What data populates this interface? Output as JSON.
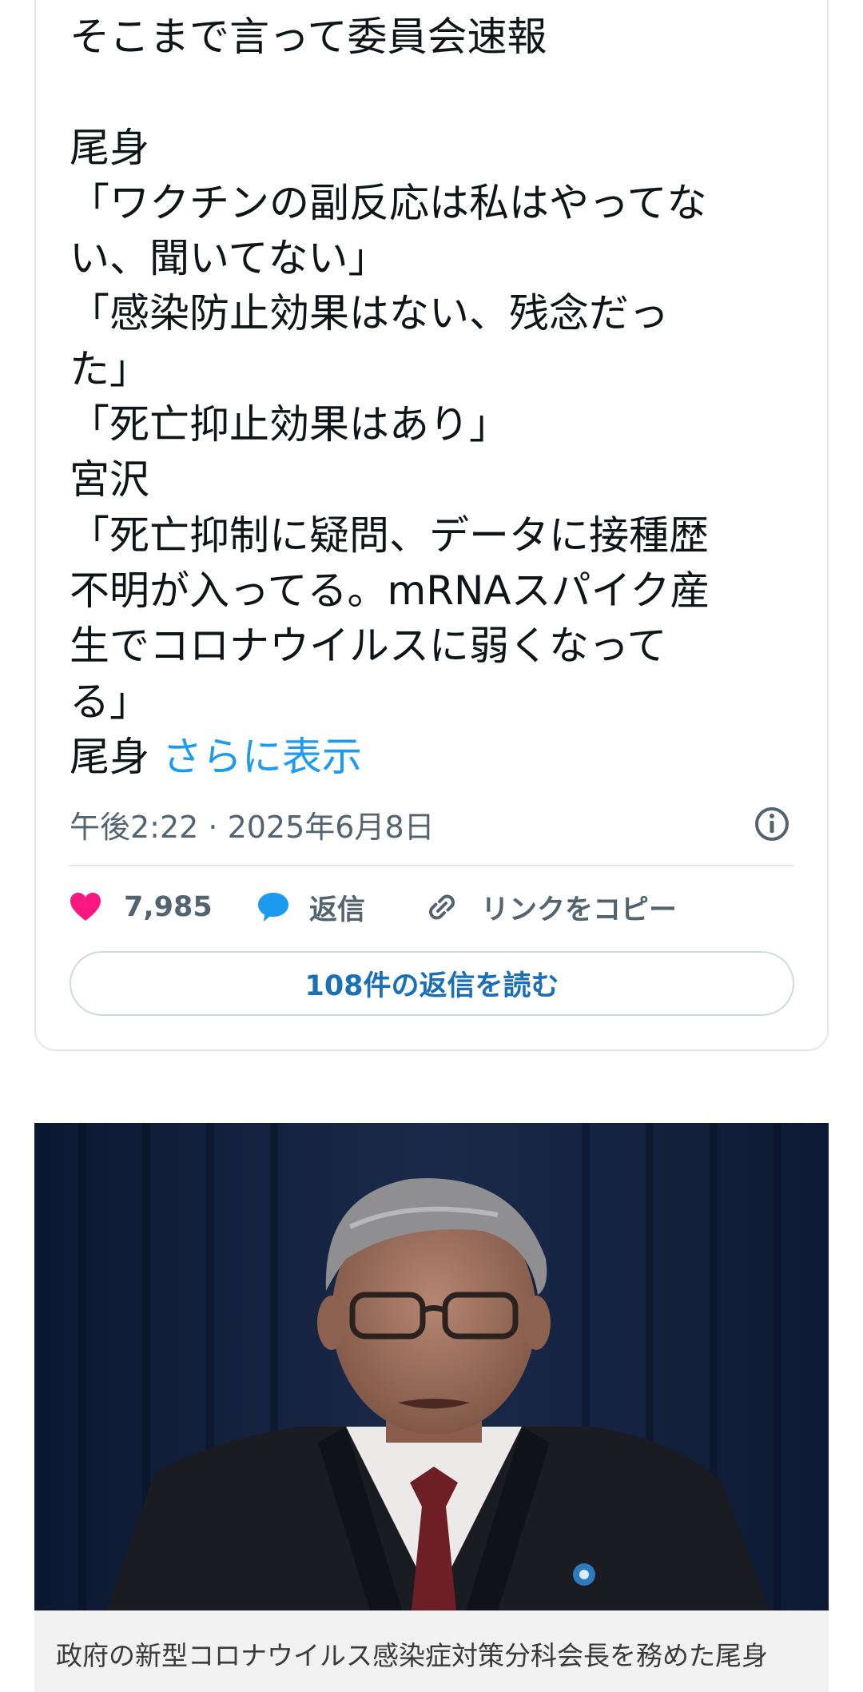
{
  "tweet": {
    "lines": [
      "そこまで言って委員会速報",
      "",
      "尾身",
      "「ワクチンの副反応は私はやってな",
      "い、聞いてない」",
      "「感染防止効果はない、残念だっ",
      "た」",
      "「死亡抑止効果はあり」",
      "宮沢",
      "「死亡抑制に疑問、データに接種歴",
      "不明が入ってる。mRNAスパイク産",
      "生でコロナウイルスに弱くなって",
      "る」"
    ],
    "last_line_prefix": "尾身",
    "show_more_label": "さらに表示",
    "timestamp": "午後2:22 · 2025年6月8日",
    "like_count": "7,985",
    "reply_label": "返信",
    "copy_link_label": "リンクをコピー",
    "read_replies_label": "108件の返信を読む"
  },
  "article": {
    "caption": "政府の新型コロナウイルス感染症対策分科会長を務めた尾身"
  },
  "colors": {
    "like_heart": "#f91880",
    "reply_bubble": "#1d9bf0",
    "link_blue": "#1d9bf0",
    "text_secondary": "#536471"
  },
  "icons": {
    "info": "info-icon",
    "like": "heart-icon",
    "reply": "speech-bubble-icon",
    "copy_link": "link-icon"
  }
}
